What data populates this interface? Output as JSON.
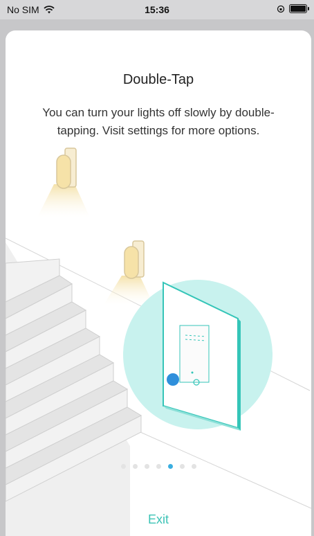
{
  "status_bar": {
    "carrier": "No SIM",
    "time": "15:36"
  },
  "screen": {
    "title": "Double-Tap",
    "description": "You can turn your lights off slowly by double-tapping. Visit settings for more options.",
    "exit_label": "Exit"
  },
  "pagination": {
    "total": 7,
    "active_index": 4
  },
  "colors": {
    "accent": "#3cc3b6",
    "active_dot": "#3aaee0",
    "circle": "#c8f2ee",
    "lamp_glow": "#f6e7b8"
  }
}
